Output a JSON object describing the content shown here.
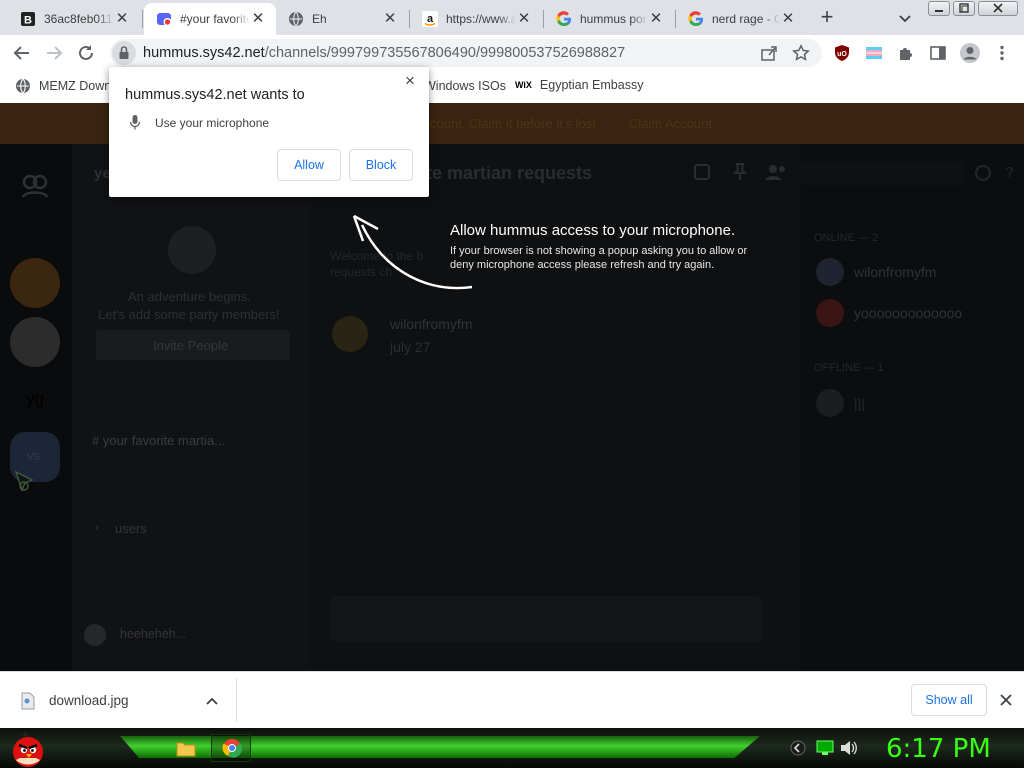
{
  "tabs": [
    {
      "title": "36ac8feb011",
      "icon": "b-square-icon",
      "active": false
    },
    {
      "title": "#your favorite",
      "icon": "app-recording-icon",
      "active": true
    },
    {
      "title": "Eh",
      "icon": "globe-icon",
      "active": false
    },
    {
      "title": "https://www.a",
      "icon": "amazon-icon",
      "active": false
    },
    {
      "title": "hummus por",
      "icon": "google-icon",
      "active": false
    },
    {
      "title": "nerd rage - G",
      "icon": "google-icon",
      "active": false
    }
  ],
  "address": {
    "host": "hummus.sys42.net",
    "path": "/channels/999799735567806490/999800537526988827"
  },
  "bookmarks": [
    {
      "label": "MEMZ Down",
      "icon": "globe-icon"
    },
    {
      "label": "Windows ISOs",
      "icon": "globe-icon"
    },
    {
      "label": "Egyptian Embassy",
      "icon": "wix-icon",
      "icon_text": "WiX"
    }
  ],
  "permission": {
    "title": "hummus.sys42.net wants to",
    "item": "Use your microphone",
    "allow": "Allow",
    "block": "Block",
    "close": "×"
  },
  "overlay": {
    "heading": "Allow hummus access to your microphone.",
    "text": "If your browser is not showing a popup asking you to allow or deny microphone access please refresh and try again."
  },
  "page": {
    "banner_text": "count. Claim it before it's lost",
    "banner_button": "Claim Account",
    "server_letters": "yg",
    "server_vs": "vs",
    "channel_header": "ye",
    "channel_title": "rite martian requests",
    "empty_title": "An adventure begins.",
    "empty_sub": "Let's add some party members!",
    "invite": "Invite People",
    "channel_item": "# your favorite martia...",
    "category": "users",
    "welcome_a": "Welcome to the b",
    "welcome_b": "requests ch",
    "message_author": "wilonfromyfm",
    "message_text": "july 27",
    "online_label": "ONLINE — 2",
    "members": [
      "wilonfromyfm",
      "yooooooooooooo"
    ],
    "offline_label": "OFFLINE — 1",
    "offline_member": "|||",
    "self_name": "heeheheh..."
  },
  "download": {
    "file": "download.jpg",
    "show_all": "Show all"
  },
  "taskbar": {
    "clock": "6:17 PM"
  },
  "colors": {
    "accent": "#1a73e8",
    "clock": "#39ff14",
    "taskbar_green": "#42d12c"
  }
}
